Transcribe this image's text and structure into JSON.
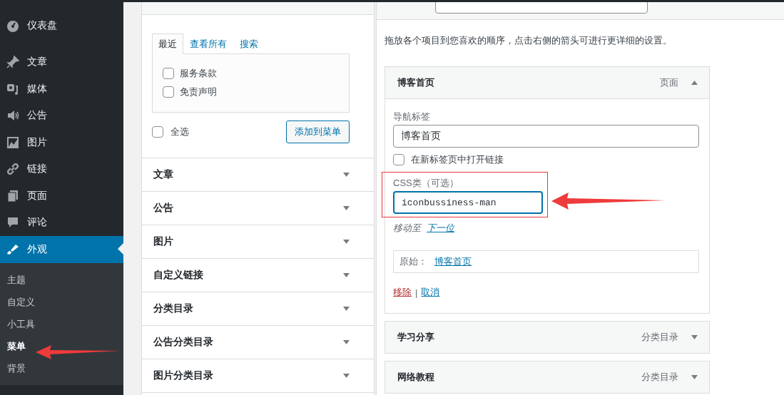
{
  "sidebar": {
    "items": [
      {
        "label": "仪表盘",
        "selected": false
      },
      {
        "label": "文章",
        "selected": false
      },
      {
        "label": "媒体",
        "selected": false
      },
      {
        "label": "公告",
        "selected": false
      },
      {
        "label": "图片",
        "selected": false
      },
      {
        "label": "链接",
        "selected": false
      },
      {
        "label": "页面",
        "selected": false
      },
      {
        "label": "评论",
        "selected": false
      },
      {
        "label": "外观",
        "selected": true,
        "submenu": [
          {
            "label": "主题",
            "selected": false
          },
          {
            "label": "自定义",
            "selected": false
          },
          {
            "label": "小工具",
            "selected": false
          },
          {
            "label": "菜单",
            "selected": true
          },
          {
            "label": "背景",
            "selected": false
          }
        ]
      }
    ]
  },
  "add_items": {
    "tabs": [
      {
        "label": "最近",
        "selected": true
      },
      {
        "label": "查看所有",
        "selected": false
      },
      {
        "label": "搜索",
        "selected": false
      }
    ],
    "items": [
      {
        "label": "服务条款",
        "checked": false
      },
      {
        "label": "免责声明",
        "checked": false
      }
    ],
    "select_all": {
      "label": "全选",
      "checked": false
    },
    "add_button": "添加到菜单",
    "sections": [
      {
        "label": "文章"
      },
      {
        "label": "公告"
      },
      {
        "label": "图片"
      },
      {
        "label": "自定义链接"
      },
      {
        "label": "分类目录"
      },
      {
        "label": "公告分类目录"
      },
      {
        "label": "图片分类目录"
      }
    ]
  },
  "menu_structure": {
    "instructions": "拖放各个项目到您喜欢的顺序，点击右侧的箭头可进行更详细的设置。",
    "items": [
      {
        "title": "博客首页",
        "type": "页面",
        "expanded": true,
        "nav_label_caption": "导航标签",
        "nav_label_value": "博客首页",
        "new_tab": {
          "label": "在新标签页中打开链接",
          "checked": false
        },
        "css_caption": "CSS类（可选）",
        "css_value": "iconbussiness-man",
        "move_caption": "移动至",
        "move_link": "下一位",
        "original_caption": "原始：",
        "original_link": "博客首页",
        "remove": "移除",
        "separator": "|",
        "cancel": "取消"
      },
      {
        "title": "学习分享",
        "type": "分类目录",
        "expanded": false
      },
      {
        "title": "网络教程",
        "type": "分类目录",
        "expanded": false
      }
    ]
  }
}
